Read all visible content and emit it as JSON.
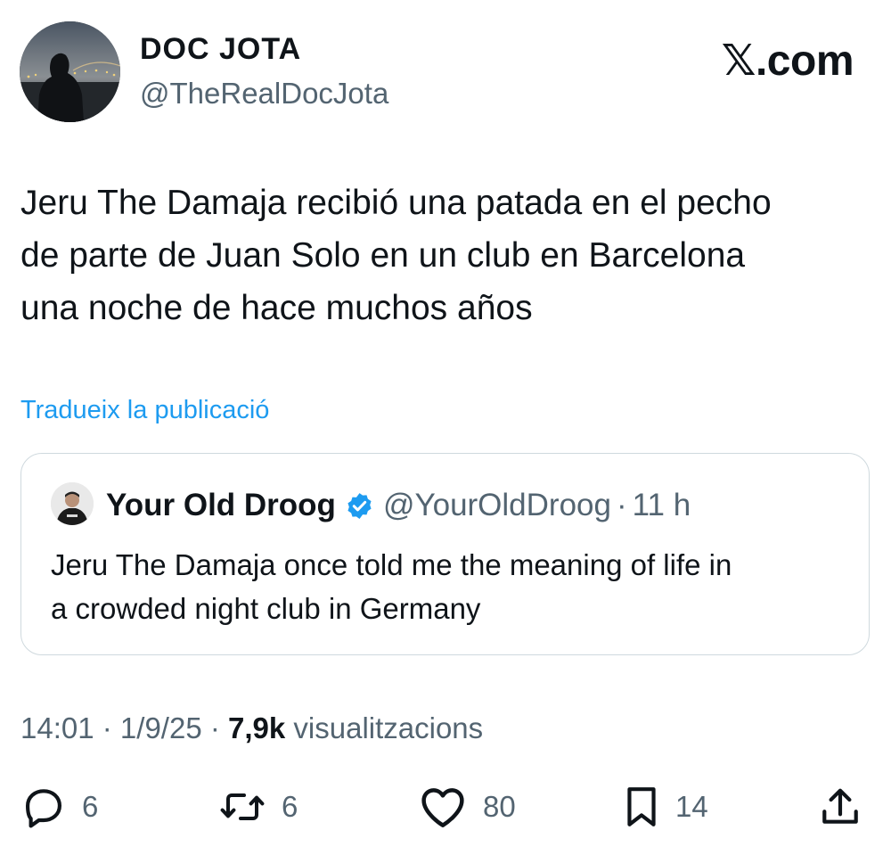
{
  "author": {
    "display_name": "DOC JOTA",
    "handle": "@TheRealDocJota"
  },
  "site_logo": {
    "glyph": "𝕏",
    "text": ".com"
  },
  "tweet": {
    "text": "Jeru The Damaja recibió una patada en el pecho\nde parte de Juan Solo en un club en Barcelona\nuna noche de hace muchos años",
    "translate_label": "Tradueix la publicació"
  },
  "quote": {
    "display_name": "Your Old Droog",
    "handle": "@YourOldDroog",
    "separator": "·",
    "time": "11 h",
    "text": "Jeru The Damaja once told me the meaning of life in\na crowded night club in Germany",
    "verified_color": "#1d9bf0"
  },
  "meta": {
    "time": "14:01",
    "sep1": " · ",
    "date": "1/9/25",
    "sep2": " · ",
    "views": "7,9k",
    "views_label": " visualitzacions"
  },
  "actions": {
    "replies": "6",
    "reposts": "6",
    "likes": "80",
    "bookmarks": "14"
  },
  "colors": {
    "text": "#0f1419",
    "secondary": "#536471",
    "link": "#1d9bf0",
    "border": "#cfd9de"
  },
  "icons": [
    "reply-icon",
    "repost-icon",
    "like-icon",
    "bookmark-icon",
    "share-icon",
    "verified-badge-icon"
  ]
}
